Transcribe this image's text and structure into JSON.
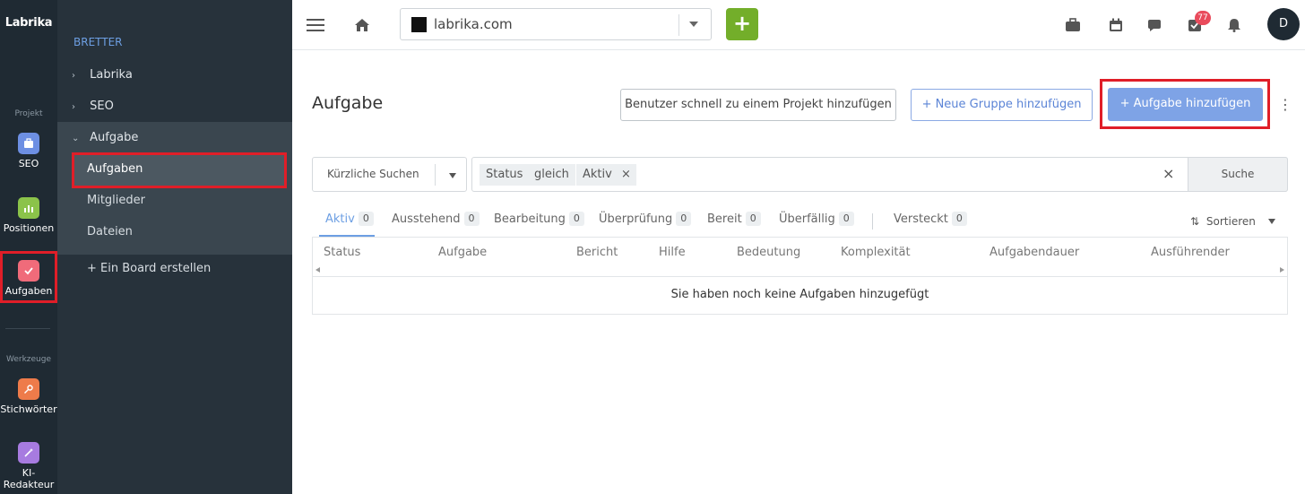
{
  "app": {
    "logo": "Labrika"
  },
  "rail": {
    "section_project": "Projekt",
    "section_tools": "Werkzeuge",
    "items": [
      {
        "label": "SEO",
        "color": "#6d8fe3"
      },
      {
        "label": "Positionen",
        "color": "#8bc34a"
      },
      {
        "label": "Aufgaben",
        "color": "#f06b7a"
      },
      {
        "label": "Stichwörter",
        "color": "#ee7b4a"
      },
      {
        "label": "KI-Redakteur",
        "label_line1": "KI-",
        "label_line2": "Redakteur",
        "color": "#a77be0"
      }
    ]
  },
  "sidebar": {
    "header": "BRETTER",
    "items": [
      {
        "label": "Labrika"
      },
      {
        "label": "SEO"
      },
      {
        "label": "Aufgabe"
      }
    ],
    "subitems": [
      {
        "label": "Aufgaben"
      },
      {
        "label": "Mitglieder"
      },
      {
        "label": "Dateien"
      }
    ],
    "create_board": "+ Ein Board erstellen"
  },
  "topbar": {
    "site": "labrika.com",
    "add_label": "+",
    "notification_count": "77",
    "avatar_initial": "D"
  },
  "main": {
    "title": "Aufgabe",
    "btn_quick_add_user": "Benutzer schnell zu einem Projekt hinzufügen",
    "btn_new_group": "+  Neue Gruppe hinzufügen",
    "btn_add_task": "+  Aufgabe hinzufügen",
    "kebab": "⋮"
  },
  "filters": {
    "recent_searches": "Kürzliche Suchen",
    "chips": [
      "Status",
      "gleich",
      "Aktiv"
    ],
    "chip_remove": "×",
    "clear": "×",
    "search_button": "Suche"
  },
  "tabs": [
    {
      "label": "Aktiv",
      "count": "0"
    },
    {
      "label": "Ausstehend",
      "count": "0"
    },
    {
      "label": "Bearbeitung",
      "count": "0"
    },
    {
      "label": "Überprüfung",
      "count": "0"
    },
    {
      "label": "Bereit",
      "count": "0"
    },
    {
      "label": "Überfällig",
      "count": "0"
    },
    {
      "label": "Versteckt",
      "count": "0"
    }
  ],
  "sort": {
    "label": "Sortieren",
    "icon": "⇅"
  },
  "table": {
    "columns": [
      "Status",
      "Aufgabe",
      "Bericht",
      "Hilfe",
      "Bedeutung",
      "Komplexität",
      "Aufgabendauer",
      "Ausführender"
    ],
    "empty_message": "Sie haben noch keine Aufgaben hinzugefügt"
  }
}
